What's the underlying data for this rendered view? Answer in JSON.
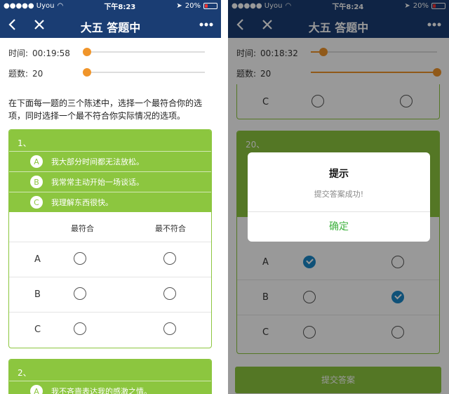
{
  "left": {
    "status": {
      "carrier": "●●●●● Uyou",
      "time": "下午8:23",
      "battery": "20%"
    },
    "nav_title": "大五 答题中",
    "time_label": "时间:",
    "time_value": "00:19:58",
    "count_label": "题数:",
    "count_value": "20",
    "instructions": "在下面每一题的三个陈述中，选择一个最符合你的选项，同时选择一个最不符合你实际情况的选项。",
    "questions": [
      {
        "number": "1、",
        "statements": [
          {
            "letter": "A",
            "text": "我大部分时间都无法放松。"
          },
          {
            "letter": "B",
            "text": "我常常主动开始一场谈话。"
          },
          {
            "letter": "C",
            "text": "我理解东西很快。"
          }
        ],
        "col_most": "最符合",
        "col_least": "最不符合",
        "rows": [
          "A",
          "B",
          "C"
        ]
      },
      {
        "number": "2、",
        "statements": [
          {
            "letter": "A",
            "text": "我不吝啬表达我的感激之情。"
          }
        ]
      }
    ]
  },
  "right": {
    "status": {
      "carrier": "●●●●● Uyou",
      "time": "下午8:24",
      "battery": "20%"
    },
    "nav_title": "大五 答题中",
    "time_label": "时间:",
    "time_value": "00:18:32",
    "count_label": "题数:",
    "count_value": "20",
    "prev_row_label": "C",
    "question_number": "20、",
    "rows": [
      "A",
      "B",
      "C"
    ],
    "selected": {
      "most": "A",
      "least": "B"
    },
    "dialog": {
      "title": "提示",
      "message": "提交答案成功!",
      "confirm": "确定"
    },
    "submit_label": "提交答案"
  },
  "colors": {
    "navbar": "#1a3d73",
    "accent_green": "#8cc63f",
    "slider_orange": "#f0952a",
    "check_blue": "#1a88c9"
  },
  "sliders": {
    "left_time_progress": 0,
    "left_count_progress": 0,
    "right_time_progress": 0.1,
    "right_count_progress": 1.0
  }
}
